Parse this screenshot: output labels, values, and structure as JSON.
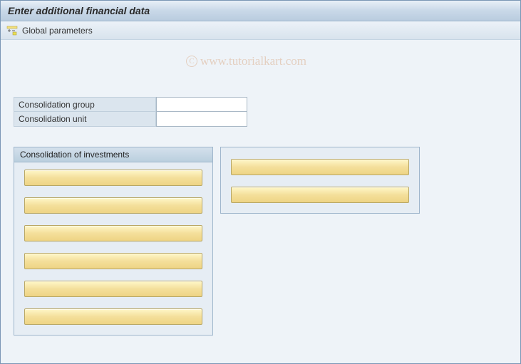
{
  "window": {
    "title": "Enter additional financial data"
  },
  "toolbar": {
    "global_params_label": "Global parameters"
  },
  "watermark": {
    "text": "www.tutorialkart.com"
  },
  "fields": {
    "consolidation_group": {
      "label": "Consolidation group",
      "value": ""
    },
    "consolidation_unit": {
      "label": "Consolidation unit",
      "value": ""
    }
  },
  "groups": {
    "left": {
      "title": "Consolidation of investments",
      "buttons": [
        "",
        "",
        "",
        "",
        "",
        ""
      ]
    },
    "right": {
      "title": "",
      "buttons": [
        "",
        ""
      ]
    }
  }
}
